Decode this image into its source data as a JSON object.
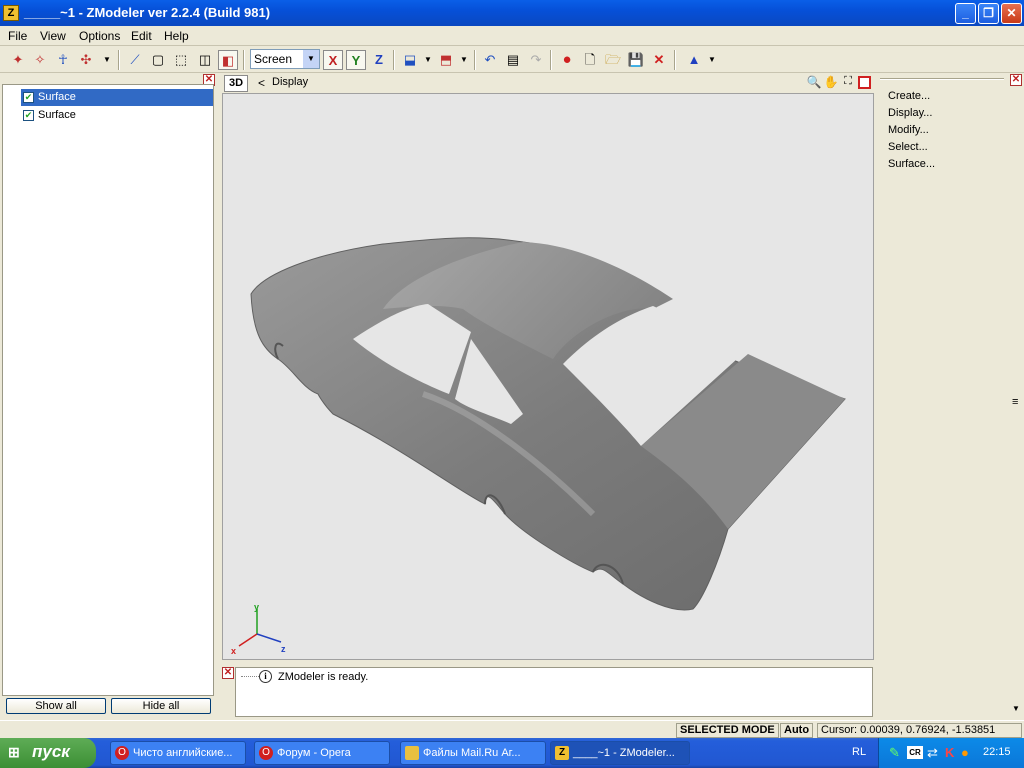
{
  "window": {
    "app_icon_letter": "Z",
    "title": "_____~1 - ZModeler ver 2.2.4 (Build 981)",
    "minimize": "_",
    "maximize": "❐",
    "close": "✕"
  },
  "menu": [
    "File",
    "View",
    "Options",
    "Edit",
    "Help"
  ],
  "toolbar": {
    "coord_system_value": "Screen",
    "axis_x": "X",
    "axis_y": "Y",
    "axis_z": "Z"
  },
  "left_panel": {
    "items": [
      {
        "label": "Surface",
        "checked": true,
        "selected": true
      },
      {
        "label": "Surface",
        "checked": true,
        "selected": false
      }
    ],
    "show_all": "Show all",
    "hide_all": "Hide all"
  },
  "viewport": {
    "mode_label": "3D",
    "back_arrow": "<",
    "display_label": "Display",
    "axis_labels": {
      "x": "x",
      "y": "y",
      "z": "z"
    }
  },
  "right_panel": {
    "commands": [
      "Create...",
      "Display...",
      "Modify...",
      "Select...",
      "Surface..."
    ]
  },
  "log": {
    "message": "ZModeler is ready."
  },
  "status": {
    "mode": "SELECTED MODE",
    "auto": "Auto",
    "cursor": "Cursor: 0.00039, 0.76924, -1.53851"
  },
  "taskbar": {
    "start": "пуск",
    "tasks": [
      {
        "label": "Чисто английские...",
        "color": "#d02020"
      },
      {
        "label": "Форум - Opera",
        "color": "#d02020"
      },
      {
        "label": "Файлы Mail.Ru Аг...",
        "color": "#e8c040"
      },
      {
        "label": "____~1 - ZModeler...",
        "color": "#f0c030"
      }
    ],
    "lang": "RL",
    "tray_badge": "CR",
    "clock": "22:15"
  },
  "colors": {
    "titlebar": "#0650d8",
    "selection": "#316ac5",
    "viewport_bg": "#e6e6e6",
    "model": "#8a8a8a"
  }
}
